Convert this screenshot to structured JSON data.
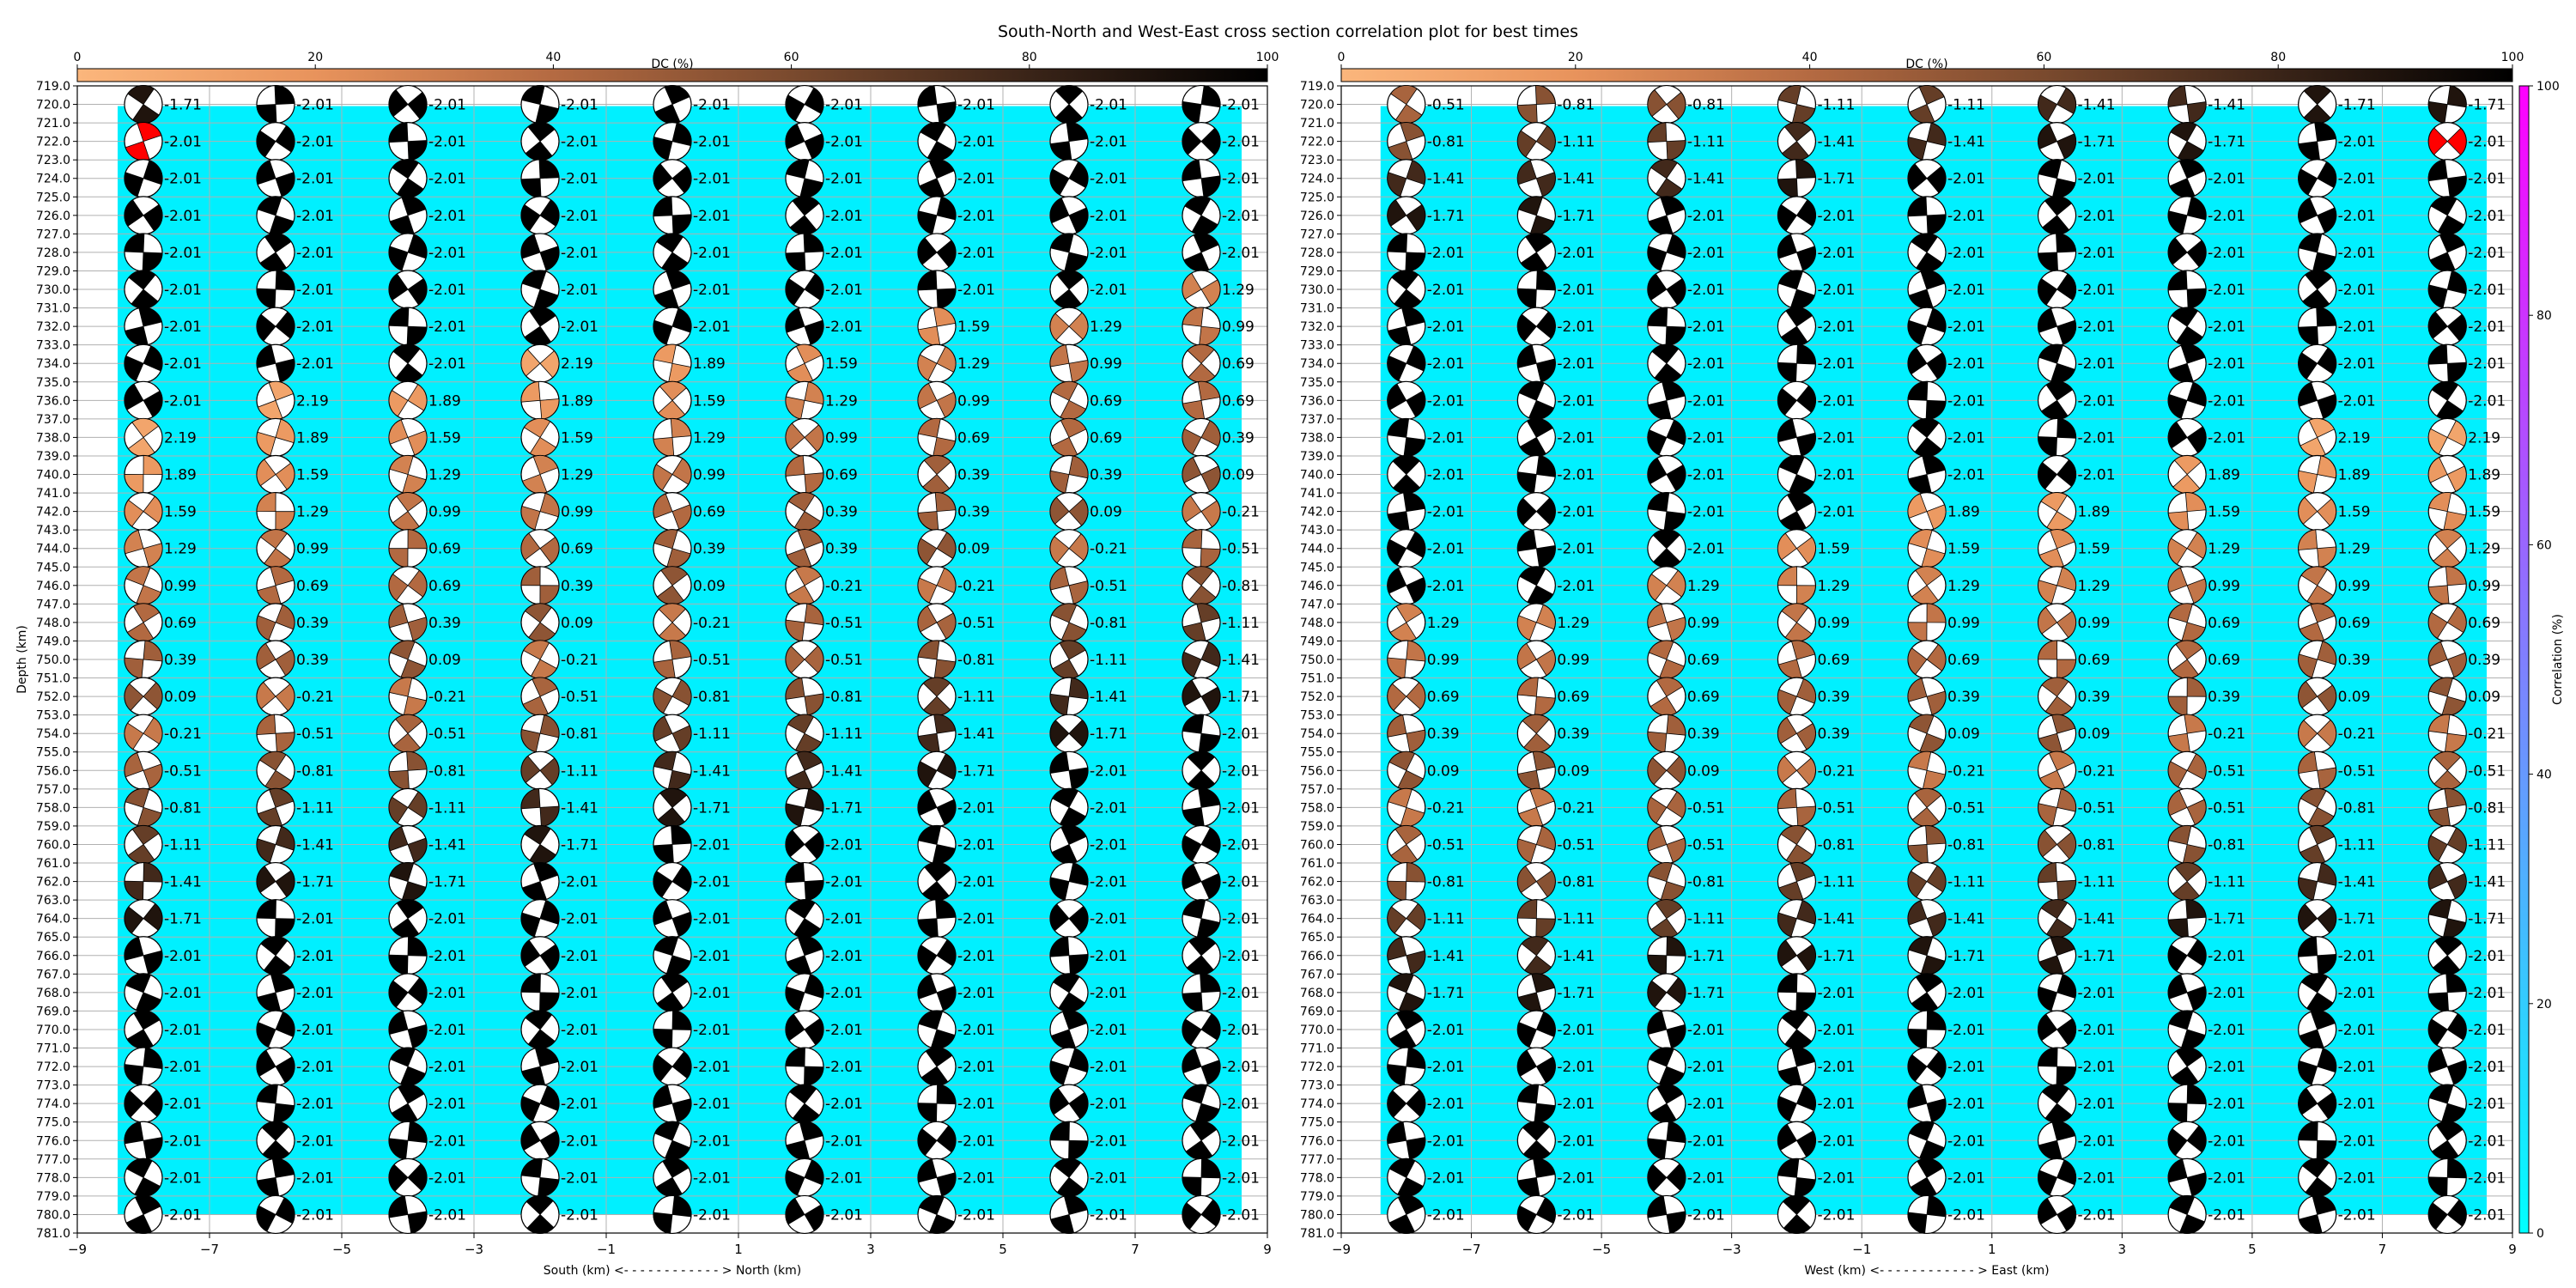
{
  "title": "South-North and West-East cross section correlation plot for best times",
  "colors": {
    "background": "#00f0ff",
    "selected_beachball": "#ff0000",
    "dc_colormap": [
      "#fbb67c",
      "#e8935c",
      "#b46a42",
      "#7a4a2e",
      "#3a2418",
      "#000000"
    ],
    "correlation_colormap": [
      "#00ffff",
      "#ff00ff"
    ]
  },
  "dc_colorbar": {
    "label": "DC (%)",
    "range": [
      0,
      100
    ],
    "ticks": [
      "0",
      "20",
      "40",
      "60",
      "80",
      "100"
    ]
  },
  "correlation_colorbar": {
    "label": "Correlation (%)",
    "range": [
      0,
      100
    ],
    "ticks": [
      "0",
      "20",
      "40",
      "60",
      "80",
      "100"
    ]
  },
  "chart_data": [
    {
      "type": "scatter",
      "panel": "south-north",
      "xlabel": "South (km) <- - - - - - - - - - - - > North (km)",
      "ylabel": "Depth (km)",
      "xlim": [
        -9,
        9
      ],
      "ylim": [
        781,
        719
      ],
      "xticks": [
        -9,
        -7,
        -5,
        -3,
        -1,
        1,
        3,
        5,
        7,
        9
      ],
      "xtick_labels": [
        "−9",
        "−7",
        "−5",
        "−3",
        "−1",
        "1",
        "3",
        "5",
        "7",
        "9"
      ],
      "grid": true,
      "x": [
        -8,
        -6,
        -4,
        -2,
        0,
        2,
        4,
        6,
        8
      ],
      "depths": [
        720,
        722,
        724,
        726,
        728,
        730,
        732,
        734,
        736,
        738,
        740,
        742,
        744,
        746,
        748,
        750,
        752,
        754,
        756,
        758,
        760,
        762,
        764,
        766,
        768,
        770,
        772,
        774,
        776,
        778,
        780
      ],
      "selected": {
        "x": -8,
        "depth": 722
      },
      "labels": [
        [
          "-1.71",
          "-2.01",
          "-2.01",
          "-2.01",
          "-2.01",
          "-2.01",
          "-2.01",
          "-2.01",
          "-2.01"
        ],
        [
          "-2.01",
          "-2.01",
          "-2.01",
          "-2.01",
          "-2.01",
          "-2.01",
          "-2.01",
          "-2.01",
          "-2.01"
        ],
        [
          "-2.01",
          "-2.01",
          "-2.01",
          "-2.01",
          "-2.01",
          "-2.01",
          "-2.01",
          "-2.01",
          "-2.01"
        ],
        [
          "-2.01",
          "-2.01",
          "-2.01",
          "-2.01",
          "-2.01",
          "-2.01",
          "-2.01",
          "-2.01",
          "-2.01"
        ],
        [
          "-2.01",
          "-2.01",
          "-2.01",
          "-2.01",
          "-2.01",
          "-2.01",
          "-2.01",
          "-2.01",
          "-2.01"
        ],
        [
          "-2.01",
          "-2.01",
          "-2.01",
          "-2.01",
          "-2.01",
          "-2.01",
          "-2.01",
          "-2.01",
          "1.29"
        ],
        [
          "-2.01",
          "-2.01",
          "-2.01",
          "-2.01",
          "-2.01",
          "-2.01",
          "1.59",
          "1.29",
          "0.99"
        ],
        [
          "-2.01",
          "-2.01",
          "-2.01",
          "2.19",
          "1.89",
          "1.59",
          "1.29",
          "0.99",
          "0.69"
        ],
        [
          "-2.01",
          "2.19",
          "1.89",
          "1.89",
          "1.59",
          "1.29",
          "0.99",
          "0.69",
          "0.69"
        ],
        [
          "2.19",
          "1.89",
          "1.59",
          "1.59",
          "1.29",
          "0.99",
          "0.69",
          "0.69",
          "0.39"
        ],
        [
          "1.89",
          "1.59",
          "1.29",
          "1.29",
          "0.99",
          "0.69",
          "0.39",
          "0.39",
          "0.09"
        ],
        [
          "1.59",
          "1.29",
          "0.99",
          "0.99",
          "0.69",
          "0.39",
          "0.39",
          "0.09",
          "-0.21"
        ],
        [
          "1.29",
          "0.99",
          "0.69",
          "0.69",
          "0.39",
          "0.39",
          "0.09",
          "-0.21",
          "-0.51"
        ],
        [
          "0.99",
          "0.69",
          "0.69",
          "0.39",
          "0.09",
          "-0.21",
          "-0.21",
          "-0.51",
          "-0.81"
        ],
        [
          "0.69",
          "0.39",
          "0.39",
          "0.09",
          "-0.21",
          "-0.51",
          "-0.51",
          "-0.81",
          "-1.11"
        ],
        [
          "0.39",
          "0.39",
          "0.09",
          "-0.21",
          "-0.51",
          "-0.51",
          "-0.81",
          "-1.11",
          "-1.41"
        ],
        [
          "0.09",
          "-0.21",
          "-0.21",
          "-0.51",
          "-0.81",
          "-0.81",
          "-1.11",
          "-1.41",
          "-1.71"
        ],
        [
          "-0.21",
          "-0.51",
          "-0.51",
          "-0.81",
          "-1.11",
          "-1.11",
          "-1.41",
          "-1.71",
          "-2.01"
        ],
        [
          "-0.51",
          "-0.81",
          "-0.81",
          "-1.11",
          "-1.41",
          "-1.41",
          "-1.71",
          "-2.01",
          "-2.01"
        ],
        [
          "-0.81",
          "-1.11",
          "-1.11",
          "-1.41",
          "-1.71",
          "-1.71",
          "-2.01",
          "-2.01",
          "-2.01"
        ],
        [
          "-1.11",
          "-1.41",
          "-1.41",
          "-1.71",
          "-2.01",
          "-2.01",
          "-2.01",
          "-2.01",
          "-2.01"
        ],
        [
          "-1.41",
          "-1.71",
          "-1.71",
          "-2.01",
          "-2.01",
          "-2.01",
          "-2.01",
          "-2.01",
          "-2.01"
        ],
        [
          "-1.71",
          "-2.01",
          "-2.01",
          "-2.01",
          "-2.01",
          "-2.01",
          "-2.01",
          "-2.01",
          "-2.01"
        ],
        [
          "-2.01",
          "-2.01",
          "-2.01",
          "-2.01",
          "-2.01",
          "-2.01",
          "-2.01",
          "-2.01",
          "-2.01"
        ],
        [
          "-2.01",
          "-2.01",
          "-2.01",
          "-2.01",
          "-2.01",
          "-2.01",
          "-2.01",
          "-2.01",
          "-2.01"
        ],
        [
          "-2.01",
          "-2.01",
          "-2.01",
          "-2.01",
          "-2.01",
          "-2.01",
          "-2.01",
          "-2.01",
          "-2.01"
        ],
        [
          "-2.01",
          "-2.01",
          "-2.01",
          "-2.01",
          "-2.01",
          "-2.01",
          "-2.01",
          "-2.01",
          "-2.01"
        ],
        [
          "-2.01",
          "-2.01",
          "-2.01",
          "-2.01",
          "-2.01",
          "-2.01",
          "-2.01",
          "-2.01",
          "-2.01"
        ],
        [
          "-2.01",
          "-2.01",
          "-2.01",
          "-2.01",
          "-2.01",
          "-2.01",
          "-2.01",
          "-2.01",
          "-2.01"
        ],
        [
          "-2.01",
          "-2.01",
          "-2.01",
          "-2.01",
          "-2.01",
          "-2.01",
          "-2.01",
          "-2.01",
          "-2.01"
        ],
        [
          "-2.01",
          "-2.01",
          "-2.01",
          "-2.01",
          "-2.01",
          "-2.01",
          "-2.01",
          "-2.01",
          "-2.01"
        ]
      ]
    },
    {
      "type": "scatter",
      "panel": "west-east",
      "xlabel": "West (km) <- - - - - - - - - - - - > East (km)",
      "ylabel": "",
      "xlim": [
        -9,
        9
      ],
      "ylim": [
        781,
        719
      ],
      "xticks": [
        -9,
        -7,
        -5,
        -3,
        -1,
        1,
        3,
        5,
        7,
        9
      ],
      "xtick_labels": [
        "−9",
        "−7",
        "−5",
        "−3",
        "−1",
        "1",
        "3",
        "5",
        "7",
        "9"
      ],
      "grid": true,
      "x": [
        -8,
        -6,
        -4,
        -2,
        0,
        2,
        4,
        6,
        8
      ],
      "depths": [
        720,
        722,
        724,
        726,
        728,
        730,
        732,
        734,
        736,
        738,
        740,
        742,
        744,
        746,
        748,
        750,
        752,
        754,
        756,
        758,
        760,
        762,
        764,
        766,
        768,
        770,
        772,
        774,
        776,
        778,
        780
      ],
      "selected": {
        "x": 8,
        "depth": 722
      },
      "labels": [
        [
          "-0.51",
          "-0.81",
          "-0.81",
          "-1.11",
          "-1.11",
          "-1.41",
          "-1.41",
          "-1.71",
          "-1.71"
        ],
        [
          "-0.81",
          "-1.11",
          "-1.11",
          "-1.41",
          "-1.41",
          "-1.71",
          "-1.71",
          "-2.01",
          "-2.01"
        ],
        [
          "-1.41",
          "-1.41",
          "-1.41",
          "-1.71",
          "-2.01",
          "-2.01",
          "-2.01",
          "-2.01",
          "-2.01"
        ],
        [
          "-1.71",
          "-1.71",
          "-2.01",
          "-2.01",
          "-2.01",
          "-2.01",
          "-2.01",
          "-2.01",
          "-2.01"
        ],
        [
          "-2.01",
          "-2.01",
          "-2.01",
          "-2.01",
          "-2.01",
          "-2.01",
          "-2.01",
          "-2.01",
          "-2.01"
        ],
        [
          "-2.01",
          "-2.01",
          "-2.01",
          "-2.01",
          "-2.01",
          "-2.01",
          "-2.01",
          "-2.01",
          "-2.01"
        ],
        [
          "-2.01",
          "-2.01",
          "-2.01",
          "-2.01",
          "-2.01",
          "-2.01",
          "-2.01",
          "-2.01",
          "-2.01"
        ],
        [
          "-2.01",
          "-2.01",
          "-2.01",
          "-2.01",
          "-2.01",
          "-2.01",
          "-2.01",
          "-2.01",
          "-2.01"
        ],
        [
          "-2.01",
          "-2.01",
          "-2.01",
          "-2.01",
          "-2.01",
          "-2.01",
          "-2.01",
          "-2.01",
          "-2.01"
        ],
        [
          "-2.01",
          "-2.01",
          "-2.01",
          "-2.01",
          "-2.01",
          "-2.01",
          "-2.01",
          "2.19",
          "2.19"
        ],
        [
          "-2.01",
          "-2.01",
          "-2.01",
          "-2.01",
          "-2.01",
          "-2.01",
          "1.89",
          "1.89",
          "1.89"
        ],
        [
          "-2.01",
          "-2.01",
          "-2.01",
          "-2.01",
          "1.89",
          "1.89",
          "1.59",
          "1.59",
          "1.59"
        ],
        [
          "-2.01",
          "-2.01",
          "-2.01",
          "1.59",
          "1.59",
          "1.59",
          "1.29",
          "1.29",
          "1.29"
        ],
        [
          "-2.01",
          "-2.01",
          "1.29",
          "1.29",
          "1.29",
          "1.29",
          "0.99",
          "0.99",
          "0.99"
        ],
        [
          "1.29",
          "1.29",
          "0.99",
          "0.99",
          "0.99",
          "0.99",
          "0.69",
          "0.69",
          "0.69"
        ],
        [
          "0.99",
          "0.99",
          "0.69",
          "0.69",
          "0.69",
          "0.69",
          "0.69",
          "0.39",
          "0.39"
        ],
        [
          "0.69",
          "0.69",
          "0.69",
          "0.39",
          "0.39",
          "0.39",
          "0.39",
          "0.09",
          "0.09"
        ],
        [
          "0.39",
          "0.39",
          "0.39",
          "0.39",
          "0.09",
          "0.09",
          "-0.21",
          "-0.21",
          "-0.21"
        ],
        [
          "0.09",
          "0.09",
          "0.09",
          "-0.21",
          "-0.21",
          "-0.21",
          "-0.51",
          "-0.51",
          "-0.51"
        ],
        [
          "-0.21",
          "-0.21",
          "-0.51",
          "-0.51",
          "-0.51",
          "-0.51",
          "-0.51",
          "-0.81",
          "-0.81"
        ],
        [
          "-0.51",
          "-0.51",
          "-0.51",
          "-0.81",
          "-0.81",
          "-0.81",
          "-0.81",
          "-1.11",
          "-1.11"
        ],
        [
          "-0.81",
          "-0.81",
          "-0.81",
          "-1.11",
          "-1.11",
          "-1.11",
          "-1.11",
          "-1.41",
          "-1.41"
        ],
        [
          "-1.11",
          "-1.11",
          "-1.11",
          "-1.41",
          "-1.41",
          "-1.41",
          "-1.71",
          "-1.71",
          "-1.71"
        ],
        [
          "-1.41",
          "-1.41",
          "-1.71",
          "-1.71",
          "-1.71",
          "-1.71",
          "-2.01",
          "-2.01",
          "-2.01"
        ],
        [
          "-1.71",
          "-1.71",
          "-1.71",
          "-2.01",
          "-2.01",
          "-2.01",
          "-2.01",
          "-2.01",
          "-2.01"
        ],
        [
          "-2.01",
          "-2.01",
          "-2.01",
          "-2.01",
          "-2.01",
          "-2.01",
          "-2.01",
          "-2.01",
          "-2.01"
        ],
        [
          "-2.01",
          "-2.01",
          "-2.01",
          "-2.01",
          "-2.01",
          "-2.01",
          "-2.01",
          "-2.01",
          "-2.01"
        ],
        [
          "-2.01",
          "-2.01",
          "-2.01",
          "-2.01",
          "-2.01",
          "-2.01",
          "-2.01",
          "-2.01",
          "-2.01"
        ],
        [
          "-2.01",
          "-2.01",
          "-2.01",
          "-2.01",
          "-2.01",
          "-2.01",
          "-2.01",
          "-2.01",
          "-2.01"
        ],
        [
          "-2.01",
          "-2.01",
          "-2.01",
          "-2.01",
          "-2.01",
          "-2.01",
          "-2.01",
          "-2.01",
          "-2.01"
        ],
        [
          "-2.01",
          "-2.01",
          "-2.01",
          "-2.01",
          "-2.01",
          "-2.01",
          "-2.01",
          "-2.01",
          "-2.01"
        ]
      ]
    }
  ]
}
